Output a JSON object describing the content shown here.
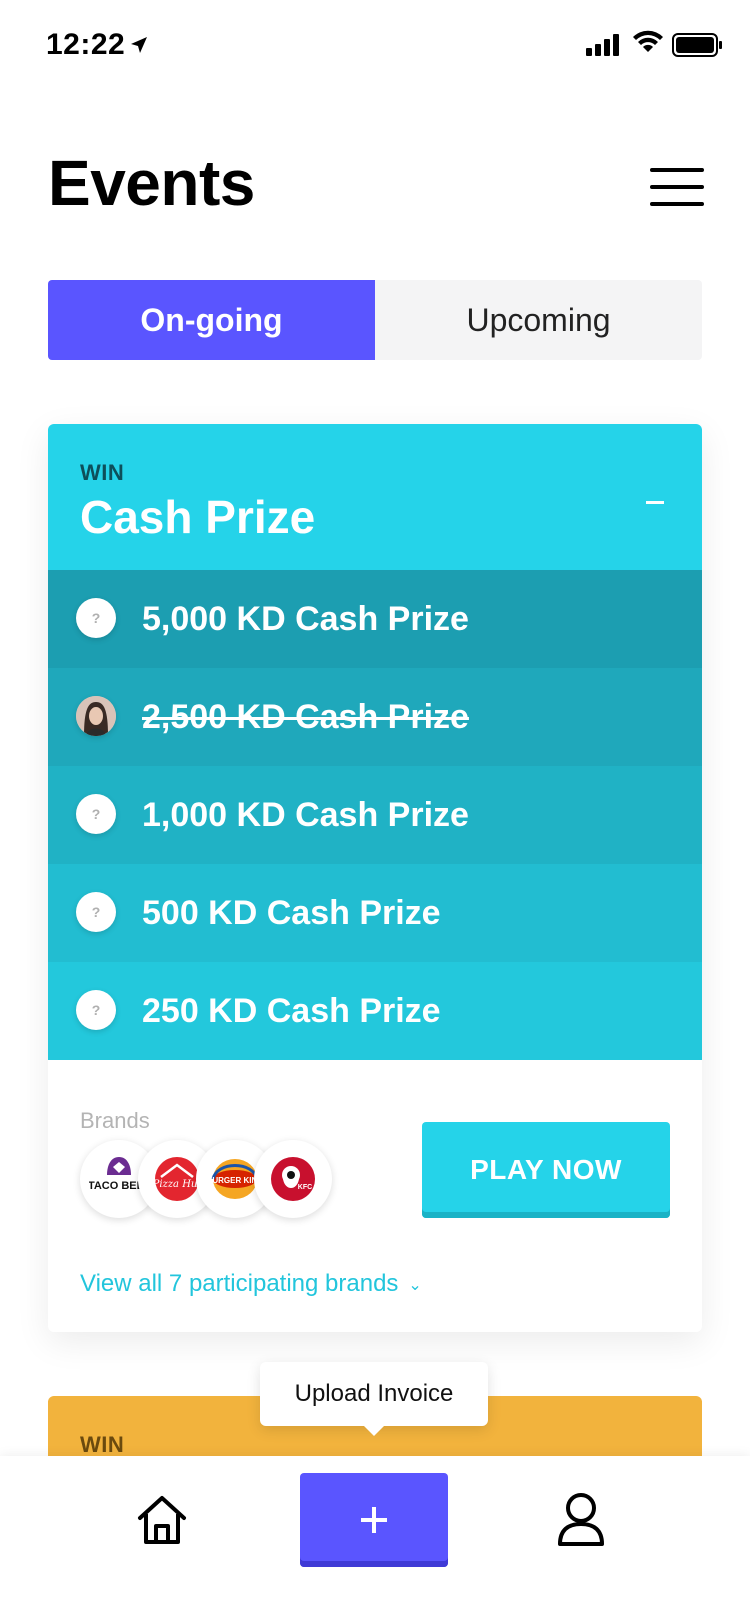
{
  "status": {
    "time": "12:22"
  },
  "header": {
    "title": "Events"
  },
  "tabs": [
    {
      "label": "On-going",
      "active": true
    },
    {
      "label": "Upcoming",
      "active": false
    }
  ],
  "card": {
    "kicker": "WIN",
    "title": "Cash Prize",
    "prizes": [
      {
        "label": "5,000 KD Cash Prize",
        "badge": "?",
        "claimed": false,
        "bg": "#1c9eb1"
      },
      {
        "label": "2,500 KD Cash Prize",
        "badge": "avatar",
        "claimed": true,
        "bg": "#1fa8bb"
      },
      {
        "label": "1,000 KD Cash Prize",
        "badge": "?",
        "claimed": false,
        "bg": "#20b2c5"
      },
      {
        "label": "500 KD Cash Prize",
        "badge": "?",
        "claimed": false,
        "bg": "#22bdd1"
      },
      {
        "label": "250 KD Cash Prize",
        "badge": "?",
        "claimed": false,
        "bg": "#23c8dc"
      }
    ],
    "brands_caption": "Brands",
    "brands": [
      {
        "name": "TACO BELL",
        "icon": "taco-bell-logo"
      },
      {
        "name": "Pizza Hut",
        "icon": "pizza-hut-logo"
      },
      {
        "name": "BURGER KING",
        "icon": "burger-king-logo"
      },
      {
        "name": "KFC",
        "icon": "kfc-logo"
      }
    ],
    "play_label": "PLAY NOW",
    "view_all_label": "View all 7 participating brands"
  },
  "card2": {
    "kicker": "WIN"
  },
  "tooltip": "Upload Invoice",
  "colors": {
    "accent": "#5a55ff",
    "cyan": "#25d3e9",
    "orange": "#f2b33d"
  }
}
